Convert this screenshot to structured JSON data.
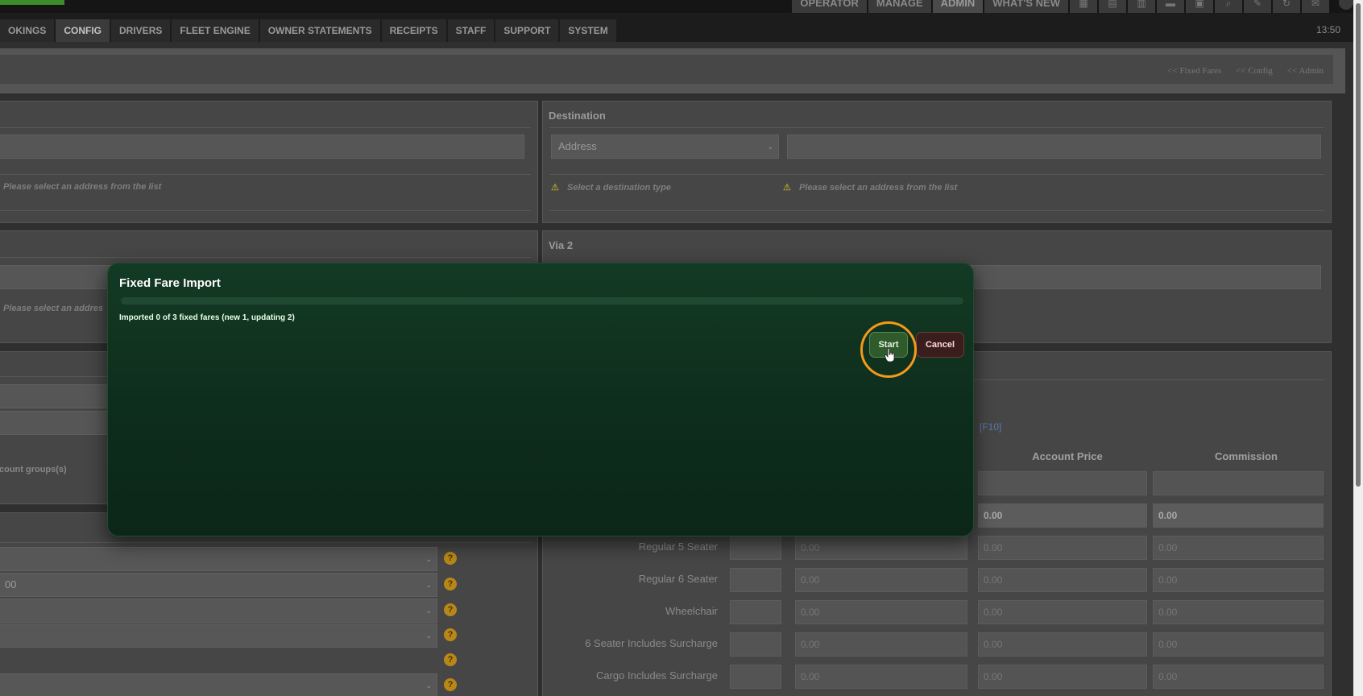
{
  "topbar": {
    "nav_items": [
      "OPERATOR",
      "MANAGE",
      "ADMIN",
      "WHAT'S NEW"
    ],
    "active_nav": "ADMIN"
  },
  "tabs": [
    "OKINGS",
    "CONFIG",
    "DRIVERS",
    "FLEET ENGINE",
    "OWNER STATEMENTS",
    "RECEIPTS",
    "STAFF",
    "SUPPORT",
    "SYSTEM"
  ],
  "active_tab": "CONFIG",
  "clock": "13:50",
  "breadcrumbs": [
    "<< Fixed Fares",
    "<< Config",
    "<< Admin"
  ],
  "origin_panel": {
    "warning": "Please select an address from the list"
  },
  "destination_panel": {
    "title": "Destination",
    "type_select": "Address",
    "warning_type": "Select a destination type",
    "warning_address": "Please select an address from the list"
  },
  "via1_panel": {
    "warning": "Please select an addres"
  },
  "via2_panel": {
    "title": "Via 2"
  },
  "left_lower": {
    "account_groups": "count groups(s)",
    "select_value": "00"
  },
  "prices": {
    "f10_link": "[F10]",
    "col_account_price": "Account Price",
    "col_commission": "Commission",
    "top_values": [
      "0.00",
      "0.00"
    ],
    "rows": [
      {
        "label": "Regular 5 Seater",
        "values": [
          "0.00",
          "0.00",
          "0.00"
        ]
      },
      {
        "label": "Regular 6 Seater",
        "values": [
          "0.00",
          "0.00",
          "0.00"
        ]
      },
      {
        "label": "Wheelchair",
        "values": [
          "0.00",
          "0.00",
          "0.00"
        ]
      },
      {
        "label": "6 Seater Includes Surcharge",
        "values": [
          "0.00",
          "0.00",
          "0.00"
        ]
      },
      {
        "label": "Cargo Includes Surcharge",
        "values": [
          "0.00",
          "0.00",
          "0.00"
        ]
      }
    ]
  },
  "modal": {
    "title": "Fixed Fare Import",
    "progress": 0,
    "status": "Imported 0 of 3 fixed fares (new 1, updating 2)",
    "start_label": "Start",
    "cancel_label": "Cancel"
  }
}
